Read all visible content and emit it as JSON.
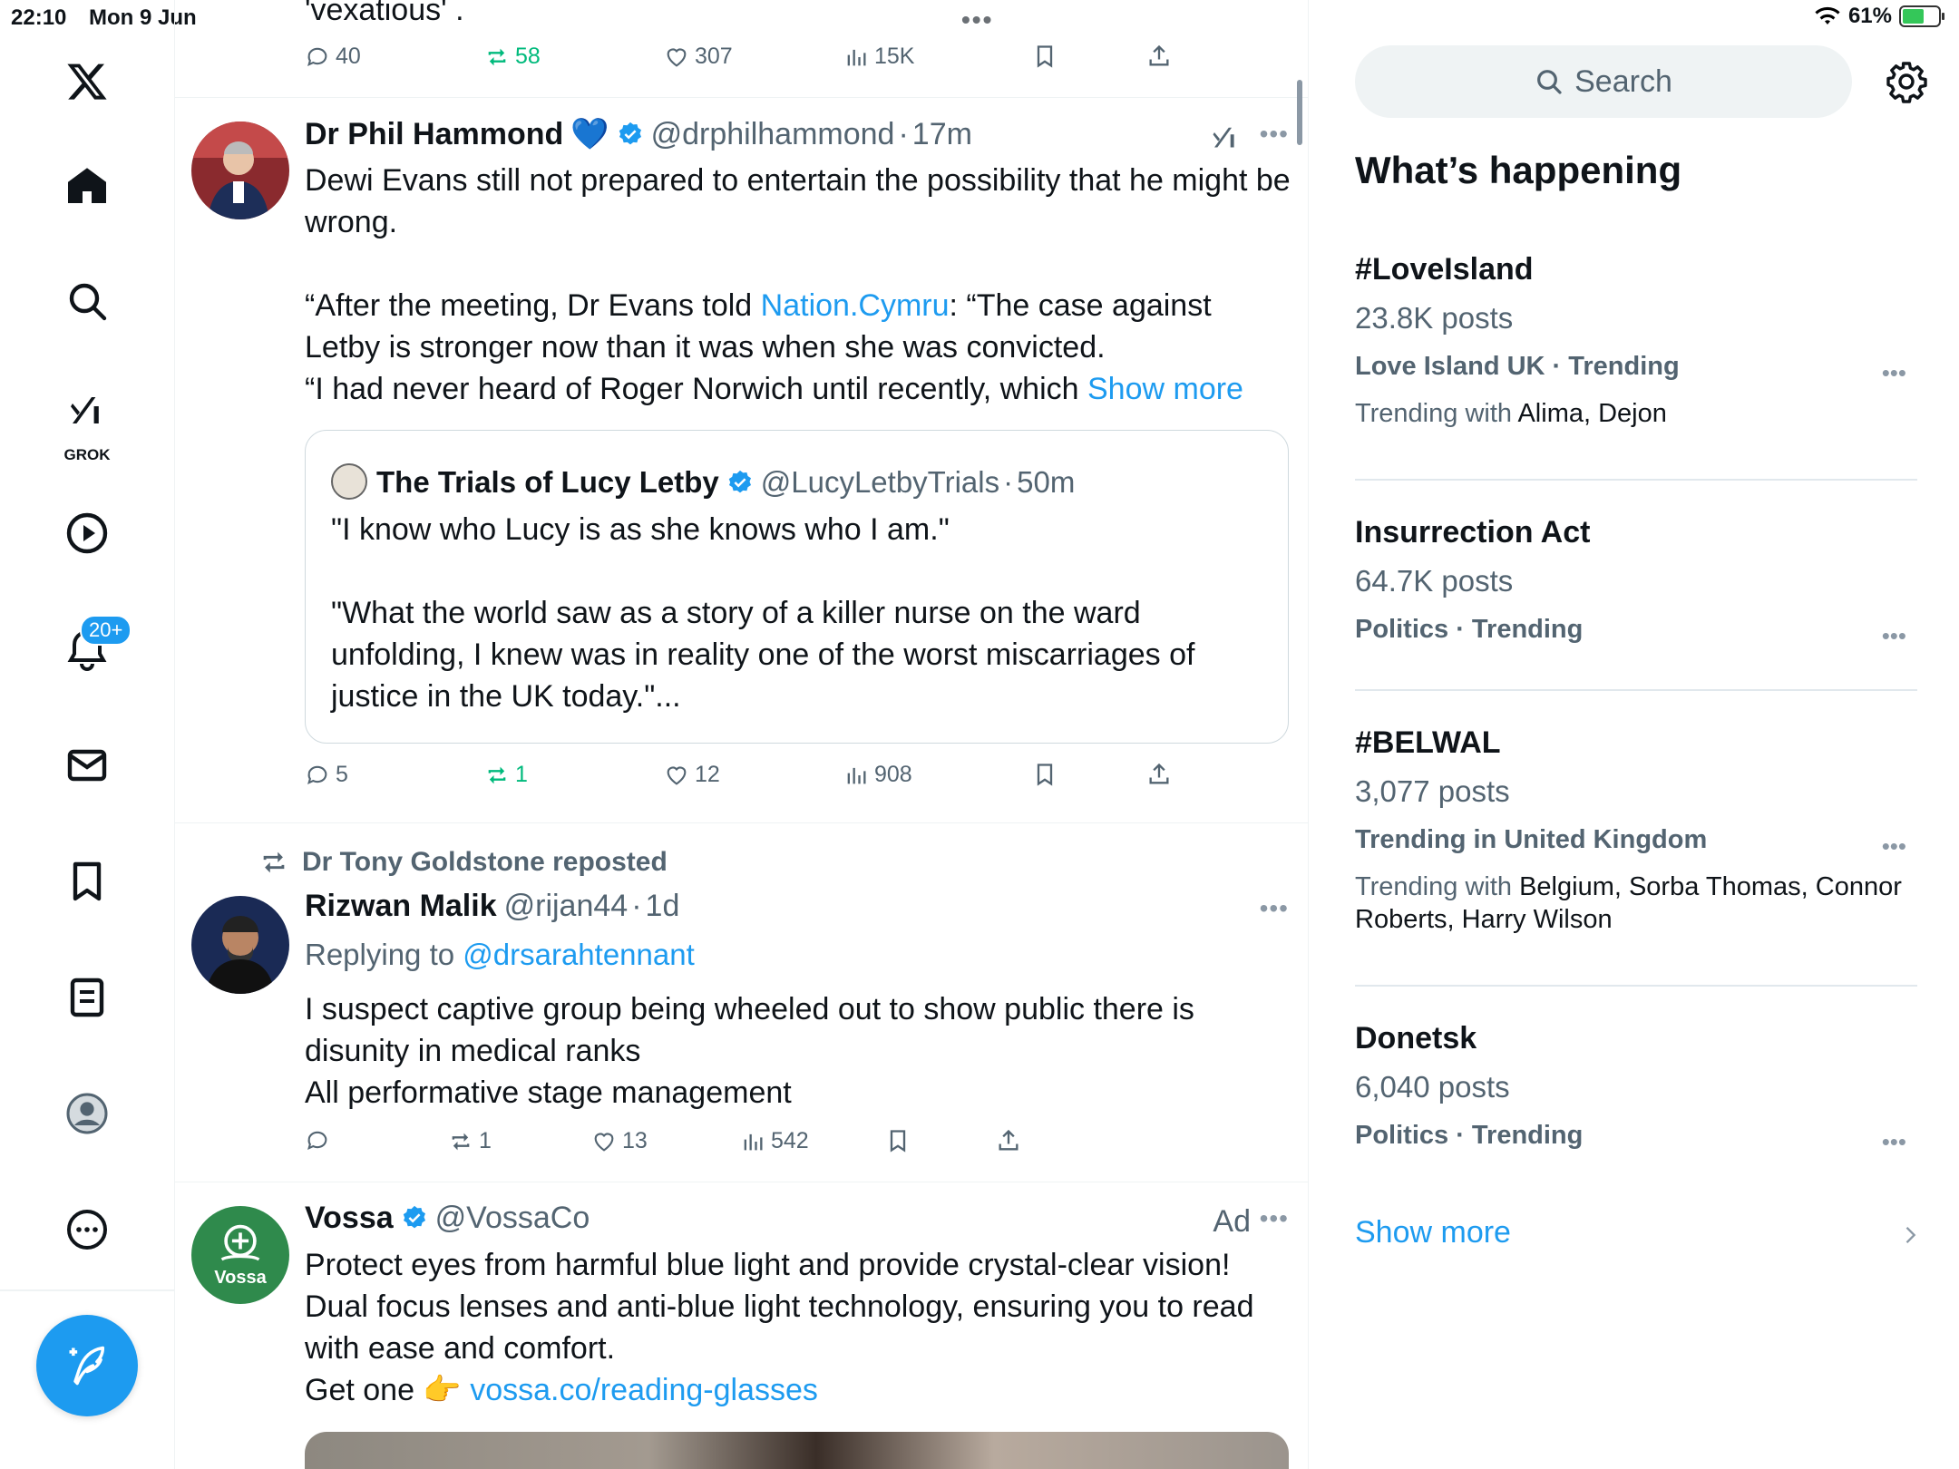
{
  "status_bar": {
    "time": "22:10",
    "date": "Mon 9 Jun",
    "battery": "61%"
  },
  "nav": {
    "grok_label": "GROK",
    "notifications_badge": "20+"
  },
  "feed": {
    "prev_tweet": {
      "text_tail": "'vexatious' .",
      "replies": "40",
      "reposts": "58",
      "likes": "307",
      "views": "15K"
    },
    "tweet1": {
      "name": "Dr Phil Hammond",
      "emoji": "💙",
      "handle": "@drphilhammond",
      "sep": "·",
      "time": "17m",
      "text_line1": "Dewi Evans still not prepared to entertain the possibility that he might be wrong.",
      "text_p2_a": "“After the meeting, Dr Evans told ",
      "text_p2_link": "Nation.Cymru",
      "text_p2_b": ": “The case against Letby is stronger now than it was when she was convicted.",
      "text_p3": "“I had never heard of Roger Norwich until recently, which ",
      "show_more": "Show more",
      "replies": "5",
      "reposts": "1",
      "likes": "12",
      "views": "908",
      "quote": {
        "name": "The Trials of Lucy Letby",
        "handle": "@LucyLetbyTrials",
        "sep": "·",
        "time": "50m",
        "text1": "\"I know who Lucy is as she knows who I am.\"",
        "text2": "\"What the world saw as a story of a killer nurse on the ward unfolding, I knew was in reality one of the worst miscarriages of justice in the UK today.\"..."
      }
    },
    "tweet2": {
      "reposted_by": "Dr Tony Goldstone reposted",
      "name": "Rizwan Malik",
      "handle": "@rijan44",
      "sep": "·",
      "time": "1d",
      "replying_to_label": "Replying to ",
      "replying_to": "@drsarahtennant",
      "text1": "I suspect captive group being wheeled out to show public there is disunity in medical ranks",
      "text2": "All performative stage management",
      "reposts": "1",
      "likes": "13",
      "views": "542"
    },
    "tweet3": {
      "name": "Vossa",
      "handle": "@VossaCo",
      "ad_label": "Ad",
      "avatar_text": "Vossa",
      "text1": "Protect eyes from harmful blue light and provide crystal-clear vision!",
      "text2": "Dual focus lenses and anti-blue light technology, ensuring you to read with ease and comfort.",
      "text3_a": "Get one ",
      "text3_emoji": "👉",
      "text3_link": "vossa.co/reading-glasses"
    }
  },
  "sidebar": {
    "search_placeholder": "Search",
    "title": "What’s happening",
    "trends": [
      {
        "name": "#LoveIsland",
        "posts": "23.8K posts",
        "category": "Love Island UK · Trending",
        "with_label": "Trending with ",
        "with": "Alima, Dejon"
      },
      {
        "name": "Insurrection Act",
        "posts": "64.7K posts",
        "category": "Politics · Trending"
      },
      {
        "name": "#BELWAL",
        "posts": "3,077 posts",
        "category": "Trending in United Kingdom",
        "with_label": "Trending with ",
        "with": "Belgium, Sorba Thomas, Connor Roberts, Harry Wilson"
      },
      {
        "name": "Donetsk",
        "posts": "6,040 posts",
        "category": "Politics · Trending"
      }
    ],
    "show_more": "Show more"
  },
  "colors": {
    "accent": "#1d9bf0",
    "repost_green": "#00ba7c",
    "text_secondary": "#536471"
  }
}
